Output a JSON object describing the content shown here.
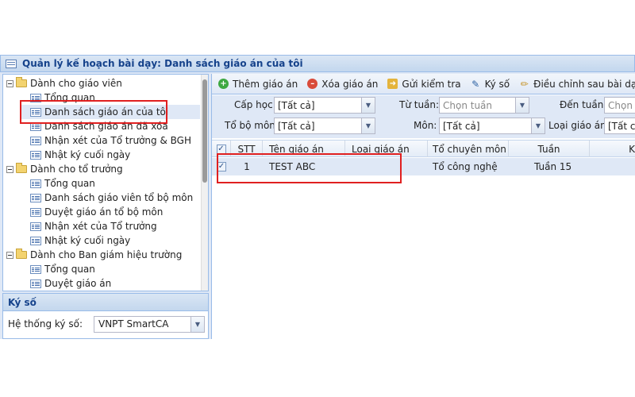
{
  "title": "Quản lý kế hoạch bài dạy: Danh sách giáo án của tôi",
  "tree": {
    "groups": [
      {
        "label": "Dành cho giáo viên",
        "items": [
          "Tổng quan",
          "Danh sách giáo án của tôi",
          "Danh sách giáo án đã xóa",
          "Nhận xét của Tổ trưởng & BGH",
          "Nhật ký cuối ngày"
        ]
      },
      {
        "label": "Dành cho tổ trưởng",
        "items": [
          "Tổng quan",
          "Danh sách giáo viên tổ bộ môn",
          "Duyệt giáo án tổ bộ môn",
          "Nhận xét của Tổ trưởng",
          "Nhật ký cuối ngày"
        ]
      },
      {
        "label": "Dành cho Ban giám hiệu trường",
        "items": [
          "Tổng quan",
          "Duyệt giáo án"
        ]
      }
    ]
  },
  "sign": {
    "header": "Ký số",
    "label": "Hệ thống ký số:",
    "value": "VNPT SmartCA"
  },
  "toolbar": {
    "add": "Thêm giáo án",
    "delete": "Xóa giáo án",
    "send": "Gửi kiểm tra",
    "sign": "Ký số",
    "adjust": "Điều chỉnh sau bài dạy"
  },
  "filters": {
    "cap_hoc_label": "Cấp học:",
    "cap_hoc_value": "[Tất cả]",
    "tu_tuan_label": "Từ tuần:",
    "tu_tuan_placeholder": "Chọn tuần",
    "den_tuan_label": "Đến tuần:",
    "den_tuan_placeholder": "Chọn t",
    "to_bo_mon_label": "Tổ bộ môn:",
    "to_bo_mon_value": "[Tất cả]",
    "mon_label": "Môn:",
    "mon_value": "[Tất cả]",
    "loai_giao_an_label": "Loại giáo án:",
    "loai_giao_an_value": "[Tất cả"
  },
  "grid": {
    "columns": [
      "STT",
      "Tên giáo án",
      "Loại giáo án",
      "Tổ chuyên môn",
      "Tuần",
      "Khố"
    ],
    "rows": [
      {
        "stt": "1",
        "ten": "TEST ABC",
        "loai": "",
        "to": "Tổ công nghệ",
        "tuan": "Tuần 15",
        "checked": true
      }
    ]
  }
}
